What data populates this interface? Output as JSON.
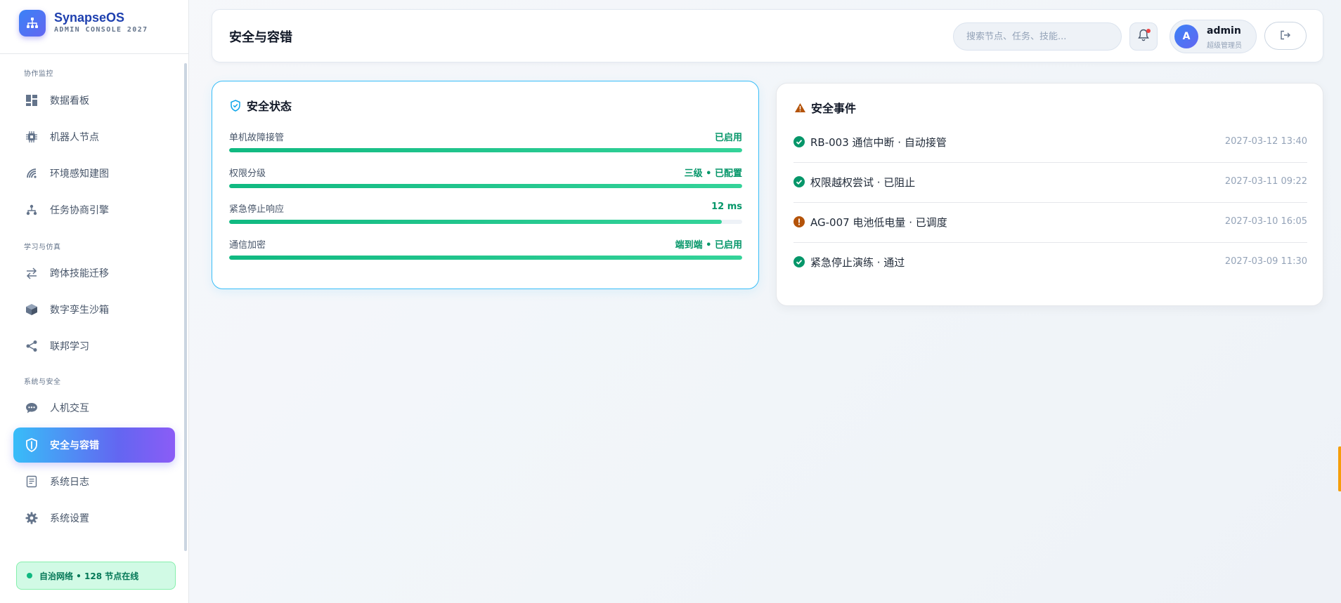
{
  "brand": {
    "name": "SynapseOS",
    "subtitle": "ADMIN CONSOLE 2027"
  },
  "sidebar": {
    "groups": [
      {
        "label": "协作监控"
      },
      {
        "label": "学习与仿真"
      },
      {
        "label": "系统与安全"
      }
    ],
    "items": [
      {
        "label": "数据看板",
        "icon": "dashboard-icon"
      },
      {
        "label": "机器人节点",
        "icon": "chip-icon"
      },
      {
        "label": "环境感知建图",
        "icon": "radar-icon"
      },
      {
        "label": "任务协商引擎",
        "icon": "sitemap-icon"
      },
      {
        "label": "跨体技能迁移",
        "icon": "transfer-icon"
      },
      {
        "label": "数字孪生沙箱",
        "icon": "cube-icon"
      },
      {
        "label": "联邦学习",
        "icon": "share-icon"
      },
      {
        "label": "人机交互",
        "icon": "chat-icon"
      },
      {
        "label": "安全与容错",
        "icon": "shield-icon",
        "active": true
      },
      {
        "label": "系统日志",
        "icon": "log-icon"
      },
      {
        "label": "系统设置",
        "icon": "gear-icon"
      }
    ],
    "network_status": "自治网络 • 128 节点在线"
  },
  "header": {
    "title": "安全与容错",
    "search_placeholder": "搜索节点、任务、技能...",
    "user": {
      "avatar_letter": "A",
      "name": "admin",
      "role": "超级管理员"
    }
  },
  "security_status": {
    "title": "安全状态",
    "metrics": [
      {
        "label": "单机故障接管",
        "value": "已启用",
        "level": 1.0
      },
      {
        "label": "权限分级",
        "value": "三级 • 已配置",
        "level": 1.0
      },
      {
        "label": "紧急停止响应",
        "value": "12 ms",
        "level": 0.96
      },
      {
        "label": "通信加密",
        "value": "端到端 • 已启用",
        "level": 1.0
      }
    ]
  },
  "security_events": {
    "title": "安全事件",
    "events": [
      {
        "text": "RB-003 通信中断 · 自动接管",
        "time": "2027-03-12 13:40",
        "status": "ok"
      },
      {
        "text": "权限越权尝试 · 已阻止",
        "time": "2027-03-11 09:22",
        "status": "ok"
      },
      {
        "text": "AG-007 电池低电量 · 已调度",
        "time": "2027-03-10 16:05",
        "status": "warn"
      },
      {
        "text": "紧急停止演练 · 通过",
        "time": "2027-03-09 11:30",
        "status": "ok"
      }
    ]
  },
  "colors": {
    "accent": "#6366f1",
    "success": "#059669",
    "warning": "#b45309",
    "brand": "#1e40af"
  }
}
